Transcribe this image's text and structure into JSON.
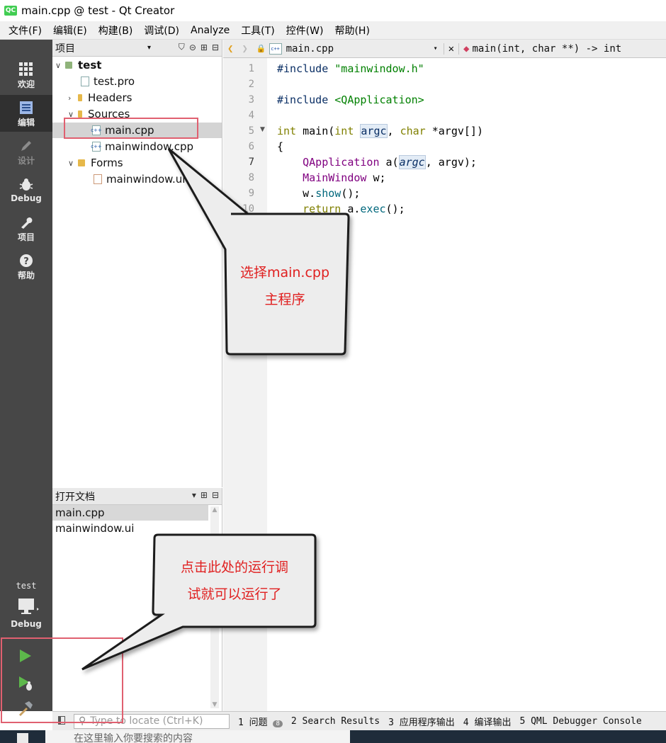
{
  "window": {
    "title": "main.cpp @ test - Qt Creator",
    "app_icon": "QC"
  },
  "menu": [
    "文件(F)",
    "编辑(E)",
    "构建(B)",
    "调试(D)",
    "Analyze",
    "工具(T)",
    "控件(W)",
    "帮助(H)"
  ],
  "modes": {
    "welcome": "欢迎",
    "edit": "编辑",
    "design": "设计",
    "debug": "Debug",
    "projects": "项目",
    "help": "帮助",
    "kit_project": "test",
    "kit_config": "Debug"
  },
  "project_panel": {
    "title": "项目",
    "tree": {
      "root": "test",
      "pro_file": "test.pro",
      "headers": "Headers",
      "sources": "Sources",
      "main_cpp": "main.cpp",
      "mainwindow_cpp": "mainwindow.cpp",
      "forms": "Forms",
      "mainwindow_ui": "mainwindow.ui"
    }
  },
  "open_docs": {
    "title": "打开文档",
    "items": [
      "main.cpp",
      "mainwindow.ui"
    ]
  },
  "editor": {
    "file_tab": "main.cpp",
    "symbol": "main(int, char **) -> int",
    "line_numbers": [
      "1",
      "2",
      "3",
      "4",
      "5",
      "6",
      "7",
      "8",
      "9",
      "10"
    ]
  },
  "status": {
    "locate_placeholder": "Type to locate (Ctrl+K)",
    "tabs": [
      "1 问题",
      "2 Search Results",
      "3 应用程序输出",
      "4 编译输出",
      "5 QML Debugger Console"
    ],
    "issues_badge": "8"
  },
  "taskbar": {
    "search_text": "在这里输入你要搜索的内容"
  },
  "annotations": {
    "callout1_line1": "选择main.cpp",
    "callout1_line2": "主程序",
    "callout2_line1": "点击此处的运行调",
    "callout2_line2": "试就可以运行了"
  },
  "colors": {
    "mode_bar": "#474747",
    "callout_text": "#e02020",
    "highlight_box": "#e06070"
  }
}
